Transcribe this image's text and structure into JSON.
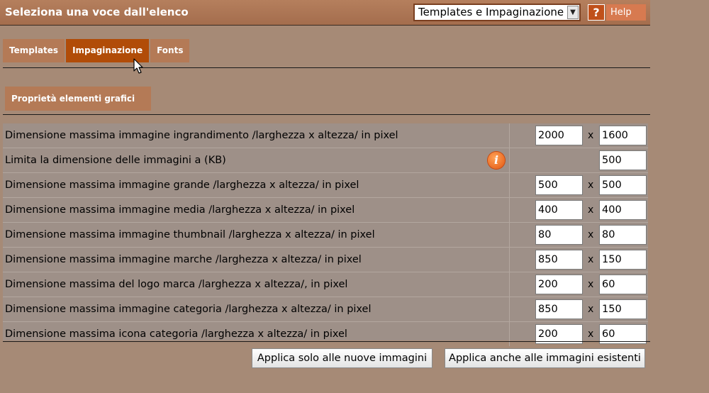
{
  "header": {
    "title": "Seleziona una voce dall'elenco",
    "dropdown_value": "Templates e Impaginazione",
    "help_icon_glyph": "?",
    "help_label": "Help"
  },
  "tabs": [
    {
      "label": "Templates"
    },
    {
      "label": "Impaginazione",
      "active": true
    },
    {
      "label": "Fonts"
    }
  ],
  "section_title": "Proprietà elementi grafici",
  "rows": [
    {
      "label": "Dimensione massima immagine ingrandimento /larghezza x altezza/ in pixel",
      "width": "2000",
      "height": "1600"
    },
    {
      "label": "Limita la dimensione delle immagini a (KB)",
      "value": "500",
      "icon": "info-icon"
    },
    {
      "label": "Dimensione massima immagine grande /larghezza x altezza/ in pixel",
      "width": "500",
      "height": "500"
    },
    {
      "label": "Dimensione massima immagine media /larghezza x altezza/ in pixel",
      "width": "400",
      "height": "400"
    },
    {
      "label": "Dimensione massima immagine thumbnail /larghezza x altezza/ in pixel",
      "width": "80",
      "height": "80"
    },
    {
      "label": "Dimensione massima immagine marche /larghezza x altezza/ in pixel",
      "width": "850",
      "height": "150"
    },
    {
      "label": "Dimensione massima del logo marca /larghezza x altezza/, in pixel",
      "width": "200",
      "height": "60"
    },
    {
      "label": "Dimensione massima immagine categoria /larghezza x altezza/ in pixel",
      "width": "850",
      "height": "150"
    },
    {
      "label": "Dimensione massima icona categoria /larghezza x altezza/ in pixel",
      "width": "200",
      "height": "60"
    }
  ],
  "times_symbol": "x",
  "info_glyph": "i",
  "buttons": {
    "apply_new": "Applica solo alle nuove immagini",
    "apply_all": "Applica anche alle immagini esistenti"
  },
  "colors": {
    "background": "#a68a76",
    "header": "#a46d4d",
    "tab": "#b47a56",
    "tab_active": "#b14c08",
    "table_bg": "#9e9088",
    "info_icon": "#e3560f"
  }
}
